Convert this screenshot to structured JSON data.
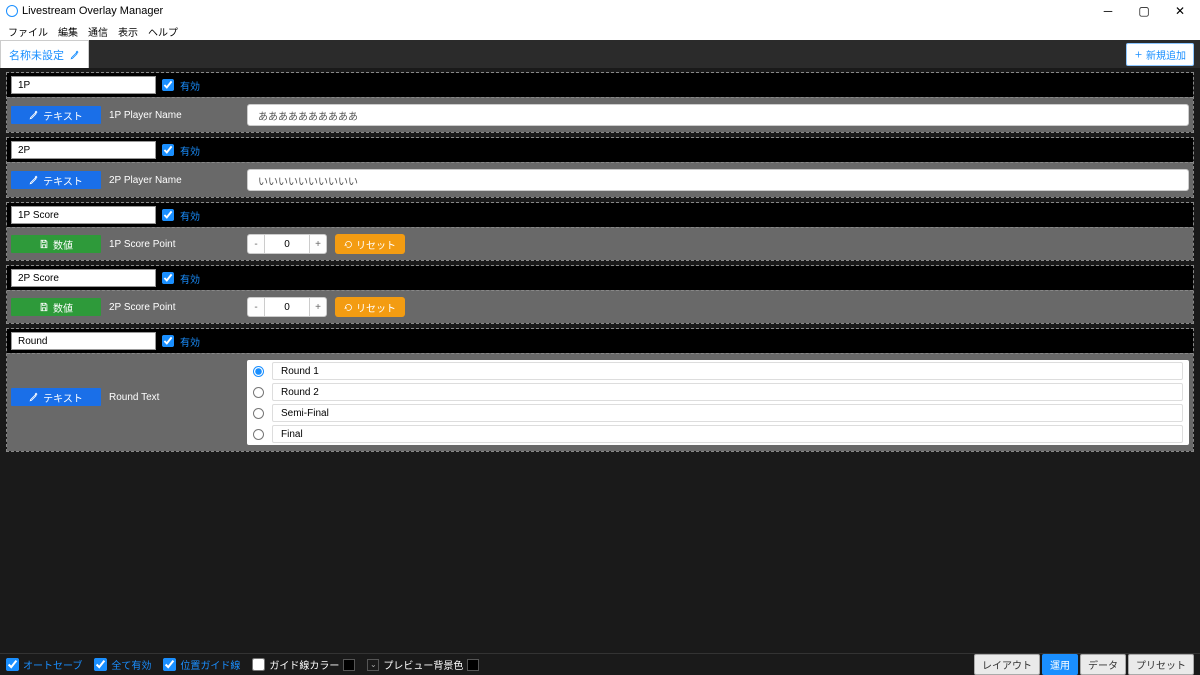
{
  "window": {
    "title": "Livestream Overlay Manager"
  },
  "menu": {
    "file": "ファイル",
    "edit": "編集",
    "comm": "通信",
    "view": "表示",
    "help": "ヘルプ"
  },
  "tab": "名称未設定",
  "add_new": "新規追加",
  "enable_label": "有効",
  "type_labels": {
    "text": "テキスト",
    "num": "数値"
  },
  "reset_label": "リセット",
  "panels": [
    {
      "name": "1P",
      "kind": "text",
      "field": "1P Player Name",
      "value": "ああああああああああ"
    },
    {
      "name": "2P",
      "kind": "text",
      "field": "2P Player Name",
      "value": "いいいいいいいいいい"
    },
    {
      "name": "1P Score",
      "kind": "num",
      "field": "1P Score Point",
      "value": "0"
    },
    {
      "name": "2P Score",
      "kind": "num",
      "field": "2P Score Point",
      "value": "0"
    },
    {
      "name": "Round",
      "kind": "radio",
      "field": "Round Text",
      "options": [
        "Round 1",
        "Round 2",
        "Semi-Final",
        "Final"
      ],
      "selected": 0
    }
  ],
  "footer": {
    "autosave": "オートセーブ",
    "enable_all": "全て有効",
    "guide": "位置ガイド線",
    "guide_color": "ガイド線カラー",
    "preview_bg": "プレビュー背景色",
    "btns": {
      "layout": "レイアウト",
      "apply": "運用",
      "data": "データ",
      "preset": "プリセット"
    }
  }
}
